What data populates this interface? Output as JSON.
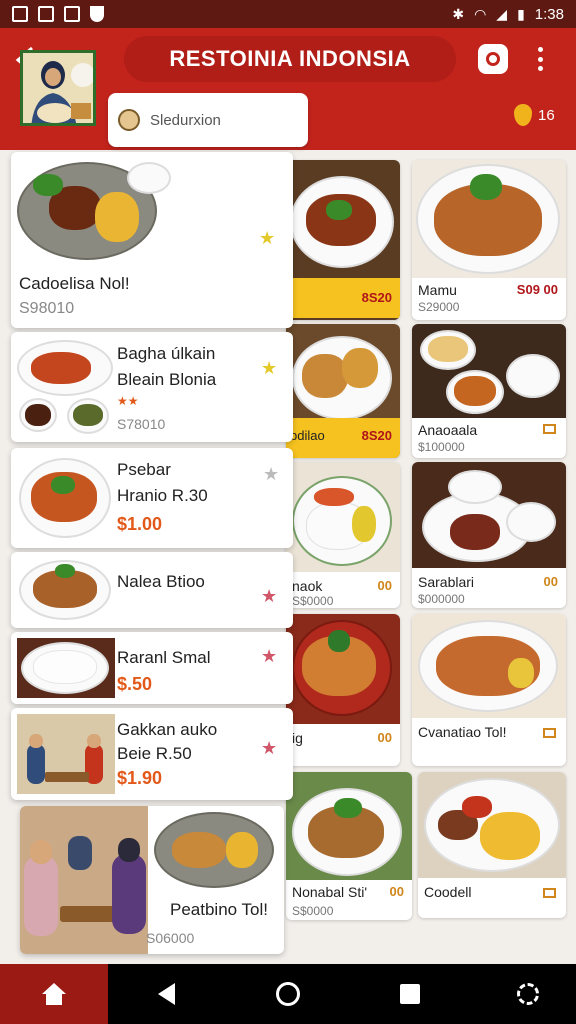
{
  "status_bar": {
    "time": "1:38",
    "icons": [
      "photo-icon",
      "gallery-icon",
      "message-icon",
      "shield-icon",
      "bluetooth-icon",
      "wifi-icon",
      "signal-icon",
      "battery-icon"
    ]
  },
  "header": {
    "title": "RESTOINIA INDONSIA",
    "search_text": "Sledurxion",
    "points_value": "16"
  },
  "featured_list": [
    {
      "name": "Cadoelisa Nol!",
      "price": "S98010"
    },
    {
      "name": "Bagha úlkain",
      "subname": "Bleain Blonia",
      "rating": "★★",
      "price": "S78010"
    },
    {
      "name": "Psebar",
      "subname": "Hranio R.30",
      "price": "$1.00"
    },
    {
      "name": "Nalea Btioo",
      "price": ""
    },
    {
      "name": "Raranl Smal",
      "price": "$.50"
    },
    {
      "name": "Gakkan auko",
      "subname": "Beie R.50",
      "price": "$1.90"
    },
    {
      "name": "Peatbino Tol!",
      "price": "S06000"
    }
  ],
  "menu_grid": [
    {
      "name": "",
      "price": "",
      "tag": "8S20"
    },
    {
      "name": "Mamu",
      "price": "S29000",
      "tag": "S09 00"
    },
    {
      "name": "bdilao",
      "price": "",
      "tag": "8S20"
    },
    {
      "name": "Anaoaala",
      "price": "$100000",
      "tag": ""
    },
    {
      "name": "naok",
      "price": "S$0000",
      "tag": "00"
    },
    {
      "name": "Sarablari",
      "price": "$000000",
      "tag": "00"
    },
    {
      "name": "ig",
      "price": "",
      "tag": "00"
    },
    {
      "name": "Cvanatiao Tol!",
      "price": "",
      "tag": ""
    },
    {
      "name": "Nonabal Sti'",
      "price": "S$0000",
      "tag": "00"
    },
    {
      "name": "Coodell",
      "price": "",
      "tag": ""
    }
  ],
  "colors": {
    "header_red": "#c2241c",
    "status_dark": "#5e1a12",
    "accent_yellow": "#f5c21f",
    "price_orange": "#e2591a"
  }
}
